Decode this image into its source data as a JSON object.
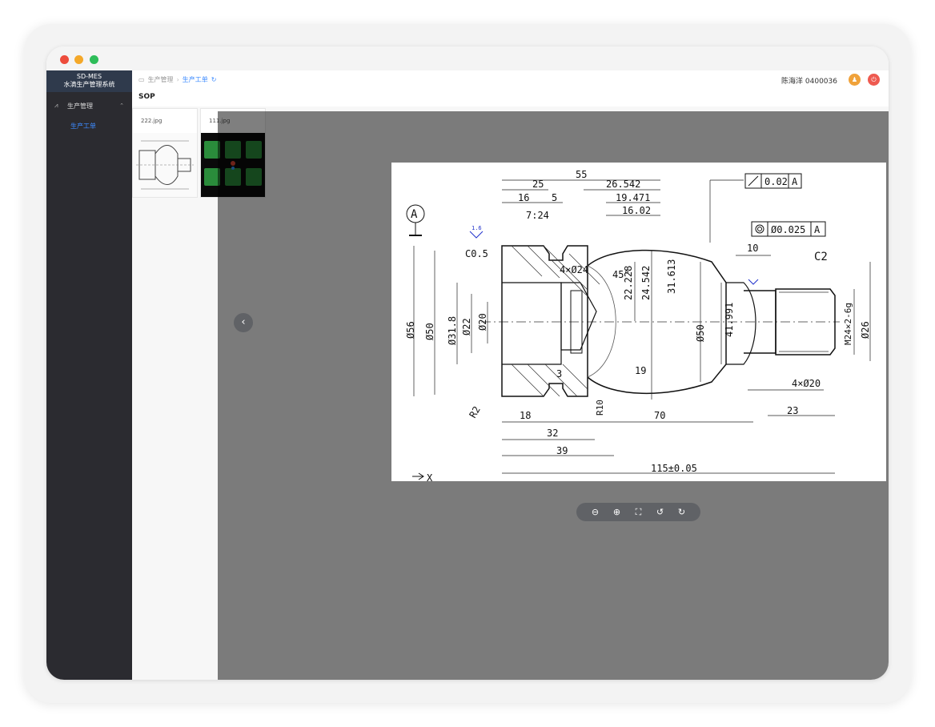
{
  "sidebar": {
    "brand_line1": "SD-MES",
    "brand_line2": "水滴生产管理系统",
    "group_label": "生产管理",
    "sub_item_label": "生产工单"
  },
  "topbar": {
    "crumb_1": "生产管理",
    "crumb_2": "生产工单",
    "user_text": "陈海洋 0400036"
  },
  "content": {
    "section_title": "SOP",
    "thumbnails": [
      {
        "name": "222.jpg"
      },
      {
        "name": "111.jpg"
      }
    ]
  },
  "drawing": {
    "dims": {
      "d55": "55",
      "d25": "25",
      "d16": "16",
      "d5": "5",
      "d26542": "26.542",
      "d19471": "19.471",
      "d1602": "16.02",
      "d724": "7:24",
      "d002": "0.02",
      "dA1": "A",
      "d0025": "Ø0.025",
      "dA2": "A",
      "d10": "10",
      "dc2": "C2",
      "dc05": "C0.5",
      "d4x24": "4×Ø24",
      "d45": "45°",
      "d22228": "22.228",
      "d24542": "24.542",
      "d31613": "31.613",
      "d41991": "41.991",
      "dphi56": "Ø56",
      "dphi50b": "Ø50",
      "dphi318": "Ø31.8",
      "dphi22": "Ø22",
      "dphi20": "Ø20",
      "dphi50": "Ø50",
      "dphi26": "Ø26",
      "dm24": "M24×2-6g",
      "d3": "3",
      "d18": "18",
      "dr10": "R10",
      "d70": "70",
      "d19": "19",
      "d4x20": "4×Ø20",
      "d23": "23",
      "d32": "32",
      "d39": "39",
      "d115": "115±0.05",
      "dr2": "R2",
      "datumA": "A",
      "rough": "1.6",
      "x": "X"
    }
  }
}
